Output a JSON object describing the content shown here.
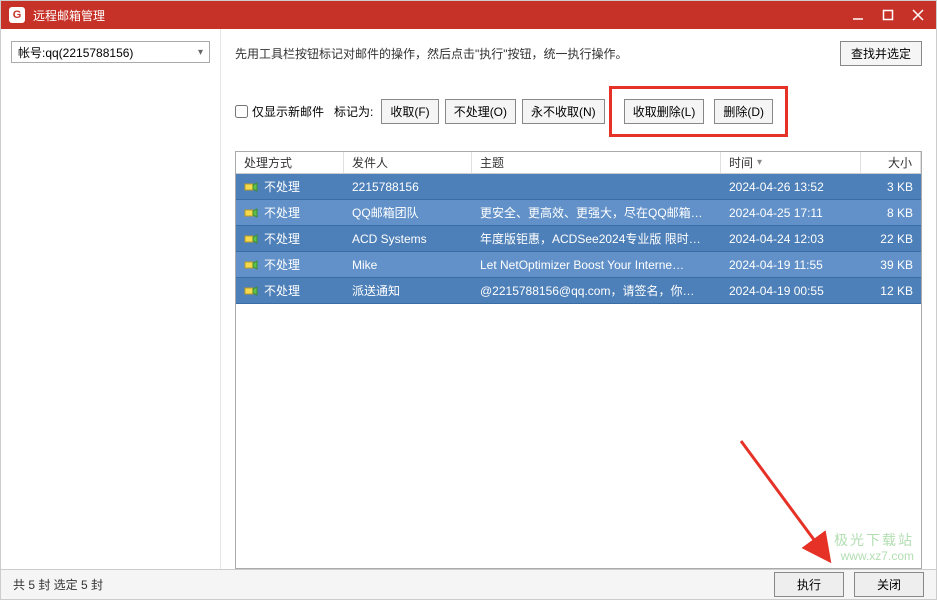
{
  "window": {
    "title": "远程邮箱管理"
  },
  "sidebar": {
    "account": "帐号:qq(2215788156)"
  },
  "toolbar": {
    "help_text": "先用工具栏按钮标记对邮件的操作，然后点击\"执行\"按钮，统一执行操作。",
    "find_select": "查找并选定",
    "show_new_only": "仅显示新邮件",
    "mark_as": "标记为:",
    "fetch": "收取(F)",
    "noaction": "不处理(O)",
    "never": "永不收取(N)",
    "fetch_del": "收取删除(L)",
    "delete": "删除(D)"
  },
  "table": {
    "headers": {
      "action": "处理方式",
      "sender": "发件人",
      "subject": "主题",
      "time": "时间",
      "size": "大小"
    },
    "rows": [
      {
        "action": "不处理",
        "sender": "2215788156",
        "subject": "",
        "time": "2024-04-26 13:52",
        "size": "3 KB"
      },
      {
        "action": "不处理",
        "sender": "QQ邮箱团队",
        "subject": "更安全、更高效、更强大，尽在QQ邮箱…",
        "time": "2024-04-25 17:11",
        "size": "8 KB"
      },
      {
        "action": "不处理",
        "sender": "ACD Systems",
        "subject": "年度版钜惠，ACDSee2024专业版 限时…",
        "time": "2024-04-24 12:03",
        "size": "22 KB"
      },
      {
        "action": "不处理",
        "sender": "Mike",
        "subject": "Let NetOptimizer Boost Your Interne…",
        "time": "2024-04-19 11:55",
        "size": "39 KB"
      },
      {
        "action": "不处理",
        "sender": "派送通知",
        "subject": "@2215788156@qq.com，请签名，你…",
        "time": "2024-04-19 00:55",
        "size": "12 KB"
      }
    ]
  },
  "statusbar": {
    "counts": "共 5 封 选定 5 封",
    "execute": "执行",
    "close": "关闭"
  },
  "watermark": {
    "line1": "极光下载站",
    "line2": "www.xz7.com"
  }
}
